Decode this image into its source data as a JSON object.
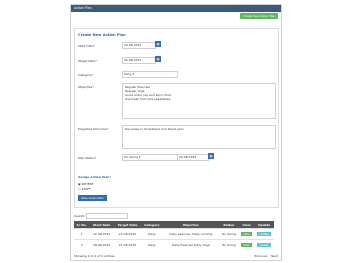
{
  "window": {
    "title": "Action Plan"
  },
  "header": {
    "create_button": "Create New Action Plan"
  },
  "form": {
    "title": "Create New Action Plan",
    "start_date_label": "Start Date*",
    "start_date_value": "20-08-2015",
    "target_date_label": "Target Date*",
    "target_date_value": "20-08-2015",
    "category_label": "Category*",
    "category_value": "Daily",
    "objective_label": "Objective*",
    "objective_lines": [
      "Regular Exercise",
      "Regular Yoga",
      "Avoid extra oily and spicy food",
      "Use fresh fruit and vegetables"
    ],
    "expected_outcome_label": "Expected Outcome*",
    "expected_outcome_value": "Decrease in cholesterol and blood pain",
    "plan_status_label": "Plan Status*",
    "plan_status_value": "On Going",
    "plan_status_date": "20-08-2015",
    "assign_label": "Assign Action Plan*",
    "assign_options": [
      "PATIENT",
      "STAFF"
    ],
    "save_button": "Save Action Plan"
  },
  "search": {
    "label": "Search:"
  },
  "table": {
    "headers": [
      "Sr No.",
      "Start Date",
      "Target Date",
      "Category",
      "Objective",
      "Status",
      "View",
      "Update"
    ],
    "rows": [
      [
        "1",
        "12-08-2015",
        "21-08-2015",
        "Daily",
        "Daily exercise, Daily running",
        "On Going",
        "View",
        "Update"
      ],
      [
        "2",
        "18-08-2015",
        "21-08-2015",
        "Daily",
        "Daily Exercise Daily Yoga",
        "On Going",
        "View",
        "Update"
      ]
    ]
  },
  "footer": {
    "info": "Showing 1 to 2 of 2 entries",
    "prev": "Previous",
    "next": "Next"
  },
  "icons": {
    "calendar": "calendar-icon"
  }
}
